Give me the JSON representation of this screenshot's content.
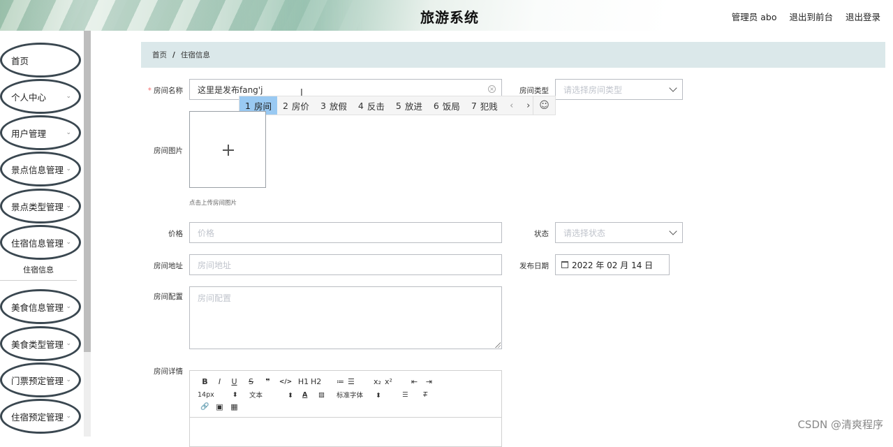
{
  "header": {
    "title": "旅游系统",
    "links": [
      "管理员 abo",
      "退出到前台",
      "退出登录"
    ]
  },
  "sidebar": {
    "items": [
      {
        "label": "首页",
        "has_children": false
      },
      {
        "label": "个人中心",
        "has_children": true
      },
      {
        "label": "用户管理",
        "has_children": true
      },
      {
        "label": "景点信息管理",
        "has_children": true
      },
      {
        "label": "景点类型管理",
        "has_children": true
      },
      {
        "label": "住宿信息管理",
        "has_children": true
      },
      {
        "label": "美食信息管理",
        "has_children": true
      },
      {
        "label": "美食类型管理",
        "has_children": true
      },
      {
        "label": "门票预定管理",
        "has_children": true
      },
      {
        "label": "住宿预定管理",
        "has_children": true
      }
    ],
    "open_submenu_item": "住宿信息"
  },
  "breadcrumb": {
    "home": "首页",
    "separator": "/",
    "current": "住宿信息"
  },
  "form": {
    "room_name": {
      "label": "房间名称",
      "required_mark": "*",
      "value": "这里是发布fang'j"
    },
    "room_type": {
      "label": "房间类型",
      "placeholder": "请选择房间类型"
    },
    "room_image": {
      "label": "房间图片",
      "tip": "点击上传房间图片"
    },
    "price": {
      "label": "价格",
      "placeholder": "价格"
    },
    "status": {
      "label": "状态",
      "placeholder": "请选择状态"
    },
    "address": {
      "label": "房间地址",
      "placeholder": "房间地址"
    },
    "publish_date": {
      "label": "发布日期",
      "value": "2022 年 02 月 14 日"
    },
    "config": {
      "label": "房间配置",
      "placeholder": "房间配置"
    },
    "details": {
      "label": "房间详情"
    }
  },
  "ime": {
    "candidates": [
      {
        "num": "1",
        "text": "房间",
        "active": true
      },
      {
        "num": "2",
        "text": "房价",
        "active": false
      },
      {
        "num": "3",
        "text": "放假",
        "active": false
      },
      {
        "num": "4",
        "text": "反击",
        "active": false
      },
      {
        "num": "5",
        "text": "放进",
        "active": false
      },
      {
        "num": "6",
        "text": "饭局",
        "active": false
      },
      {
        "num": "7",
        "text": "犯贱",
        "active": false
      }
    ],
    "prev": "‹",
    "next": "›",
    "emoji": "☺"
  },
  "editor": {
    "row1": [
      "B",
      "I",
      "U",
      "S",
      "❞",
      "</>",
      "H1",
      "H2",
      "≔",
      "☰",
      "x₂",
      "x²",
      "⇤",
      "⇥"
    ],
    "font_size": "14px",
    "text_style": "文本",
    "font_family": "标准字体",
    "row3": [
      "🔗",
      "▣",
      "▦"
    ]
  },
  "watermark": "CSDN @清爽程序"
}
